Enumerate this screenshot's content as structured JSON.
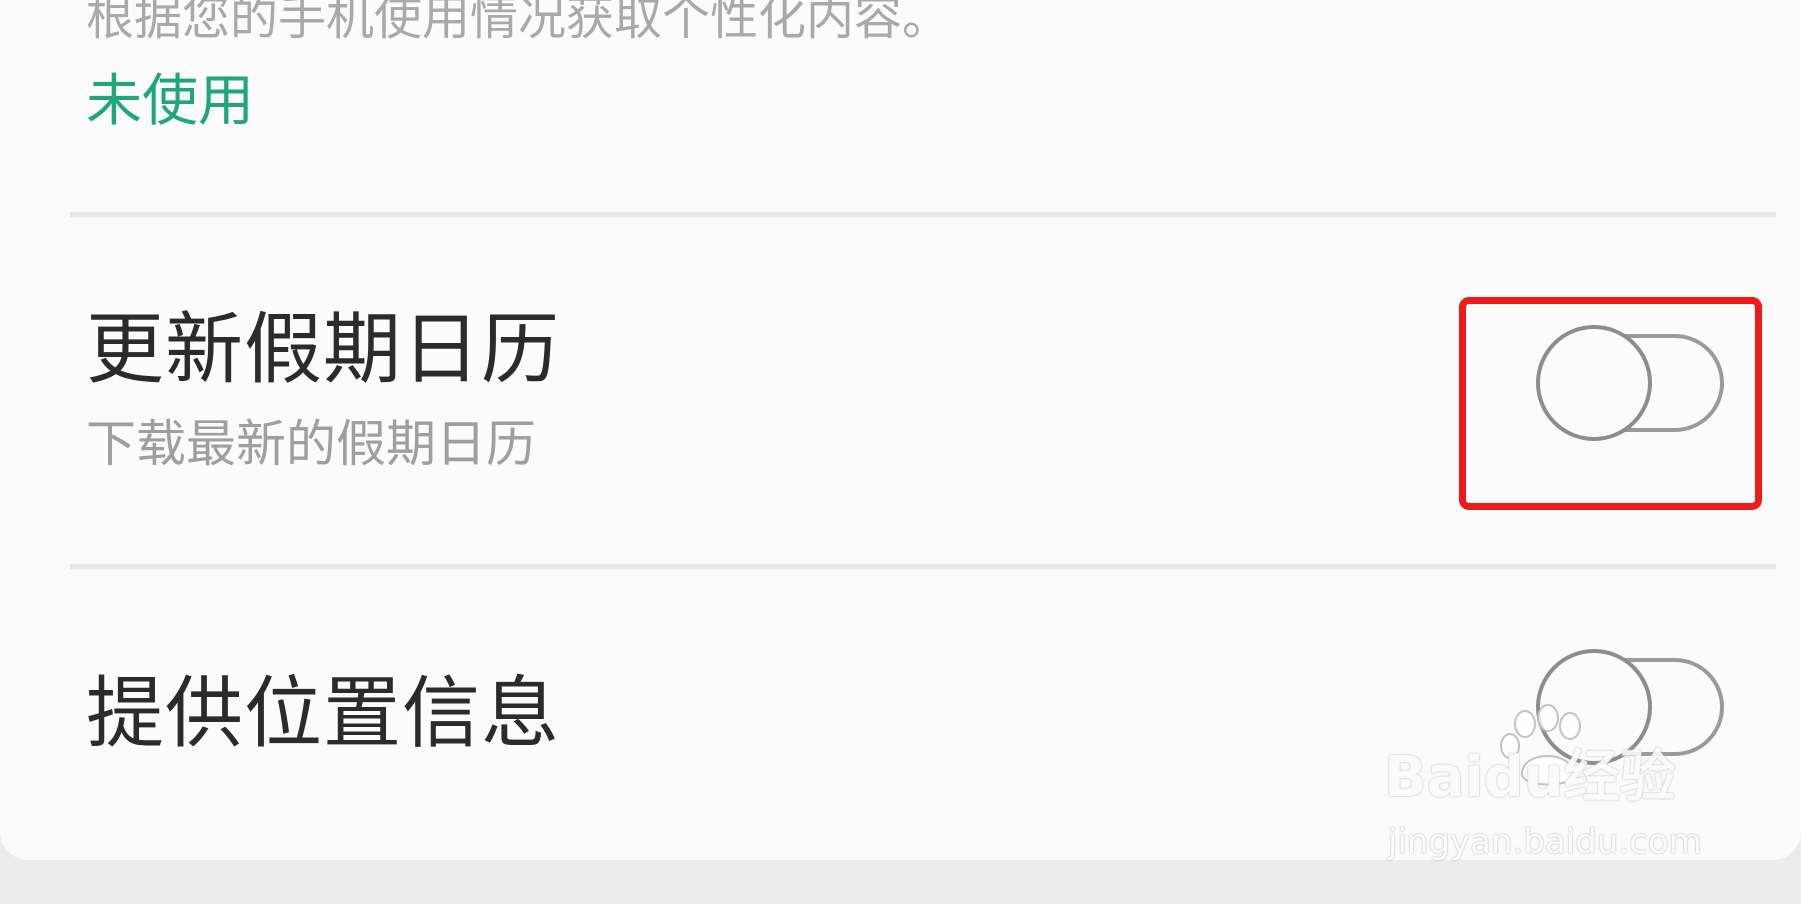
{
  "previous_item": {
    "description": "根据您的手机使用情况获取个性化内容。",
    "status": "未使用"
  },
  "settings": [
    {
      "title": "更新假期日历",
      "subtitle": "下载最新的假期日历",
      "toggle_on": false
    },
    {
      "title": "提供位置信息",
      "toggle_on": false
    }
  ],
  "colors": {
    "accent": "#1fa67a",
    "highlight": "#ef1b1b",
    "background": "#fbfbfb",
    "title_text": "#2b2b2b",
    "subtitle_text": "#9f9f9f"
  },
  "watermark": {
    "brand": "Baidu经验",
    "url": "jingyan.baidu.com",
    "icon": "paw-icon"
  }
}
